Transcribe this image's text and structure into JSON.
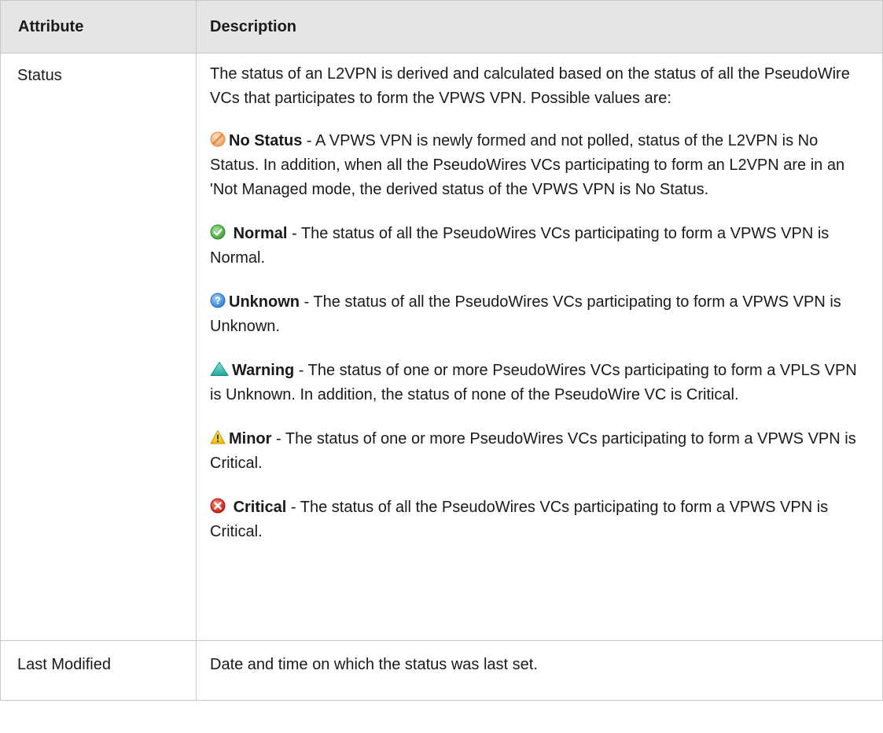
{
  "table": {
    "headers": {
      "attribute": "Attribute",
      "description": "Description"
    },
    "status_row": {
      "attribute": "Status",
      "intro": "The status of an L2VPN is derived and calculated based on the status of all the PseudoWire VCs that participates to form the VPWS VPN. Possible values are:",
      "statuses": [
        {
          "icon": "no-status-icon",
          "color": "#f0a060",
          "name": "No Status",
          "text": " - A VPWS VPN is newly formed and not polled, status of the L2VPN is No Status. In addition, when all the PseudoWires VCs participating to form an L2VPN are in an 'Not Managed mode, the derived status of the VPWS VPN is No Status."
        },
        {
          "icon": "normal-icon",
          "color": "#4caf50",
          "name": "Normal",
          "text": " - The status of all the PseudoWires VCs participating to form a VPWS VPN is Normal."
        },
        {
          "icon": "unknown-icon",
          "color": "#3d8fe0",
          "name": "Unknown",
          "text": " - The status of all the PseudoWires VCs participating to form a VPWS VPN is Unknown."
        },
        {
          "icon": "warning-icon",
          "color": "#2bbcb0",
          "name": "Warning",
          "text": " - The status of one or more PseudoWires VCs participating to form a VPLS VPN is Unknown. In addition, the status of none of the PseudoWire VC is Critical."
        },
        {
          "icon": "minor-icon",
          "color": "#f5c400",
          "name": "Minor",
          "text": " - The status of one or more PseudoWires VCs participating to form a VPWS VPN is Critical."
        },
        {
          "icon": "critical-icon",
          "color": "#d9261c",
          "name": "Critical",
          "text": " - The status of all the PseudoWires VCs participating to form a VPWS VPN is Critical."
        }
      ]
    },
    "last_modified_row": {
      "attribute": "Last Modified",
      "description": "Date and time on which the status was last set."
    }
  }
}
